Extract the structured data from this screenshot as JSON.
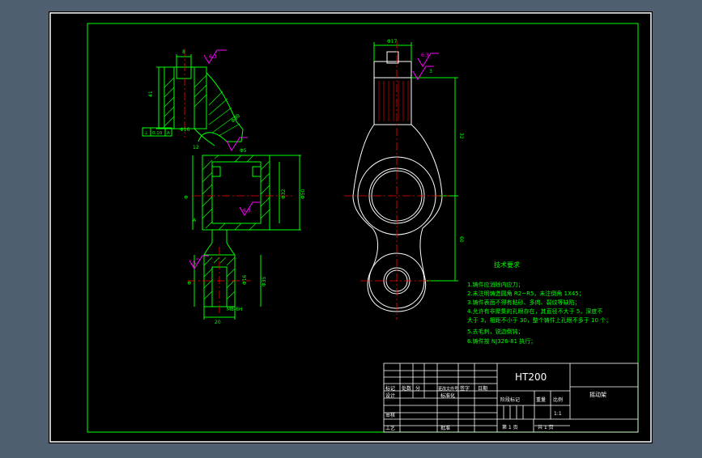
{
  "colors": {
    "background_outer": "#4f5f70",
    "paper": "#000000",
    "frame": "#ffffff",
    "border": "#00ff00",
    "geometry": "#00ff00",
    "centerline": "#ff0000",
    "hatch": "#00ff00",
    "roughness": "#ff00ff",
    "dimension": "#00ff00",
    "text": "#ffffff"
  },
  "drawing": {
    "material": "HT200",
    "part_name": "摇动架",
    "scale": "1:1",
    "sheet": "第 1 页",
    "total_sheets": "共 1 页"
  },
  "title_block": {
    "labels": {
      "mark": "标记",
      "count": "处数",
      "zone": "分",
      "change_doc": "更改文件号",
      "signature": "签字",
      "date": "日期",
      "design": "设计",
      "standard": "标准化",
      "stage_mark": "阶段标记",
      "weight": "重量",
      "scale": "比例",
      "review": "审核",
      "process": "工艺",
      "approve": "批准"
    }
  },
  "tech_requirements": {
    "heading": "技术要求",
    "items": [
      "1.铸件应消除内应力；",
      "2.未注明铸造圆角 R2~R5，未注倒角 1X45；",
      "3.铸件表面不得有粘砂、多肉、裂纹等缺陷；",
      "4.允许有非聚集的孔眼存在，其直径不大于 5，深度不",
      "  大于 3，相距不小于 30，整个铸件上孔眼不多于 10 个；",
      "5.去毛刺，锐边倒钝；",
      "6.铸件按 NJ326-81 执行；"
    ]
  },
  "dimensions": {
    "section_view": {
      "top_width": "8",
      "roughness_top": "6.3",
      "left_height": "41",
      "tolerance_frame": [
        "⊥",
        "0.10",
        "A"
      ],
      "bore_small": "Φ16",
      "arm_width": "Φ30",
      "neck": "12",
      "hub_top": "Φ5",
      "hub_inner": "Φ32",
      "hub_outer_height": "Φ50",
      "hub_roughness": "6.3",
      "hub_left": "Φ",
      "datum": "A",
      "lower_roughness": "12.5",
      "lower_height": "Φ35",
      "lower_bore": "Φ16",
      "thread": "M8-6H",
      "bottom_width": "20",
      "left_small": "Φ"
    },
    "front_view": {
      "top_width": "Φ17",
      "top_roughness": "6.3",
      "slot": "3",
      "upper_len": "32",
      "lower_len": "60"
    }
  }
}
